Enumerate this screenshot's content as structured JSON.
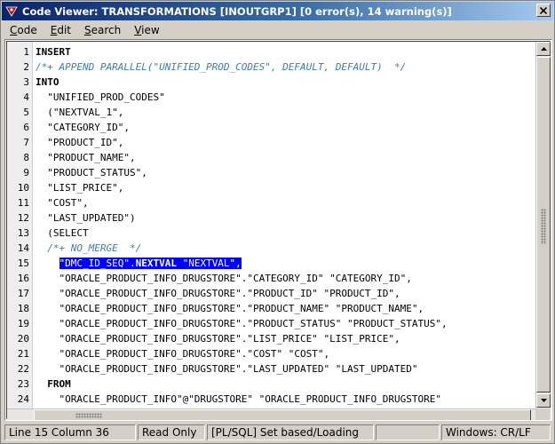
{
  "window": {
    "title": "Code Viewer: TRANSFORMATIONS [INOUTGRP1] [0 error(s), 14 warning(s)]"
  },
  "menu": [
    {
      "underline": "C",
      "rest": "ode"
    },
    {
      "underline": "E",
      "rest": "dit"
    },
    {
      "underline": "S",
      "rest": "earch"
    },
    {
      "underline": "V",
      "rest": "iew"
    }
  ],
  "code": {
    "lines": [
      {
        "n": "1",
        "segs": [
          [
            "kw",
            "INSERT"
          ]
        ]
      },
      {
        "n": "2",
        "segs": [
          [
            "cm",
            "/*+ APPEND PARALLEL(\"UNIFIED_PROD_CODES\", DEFAULT, DEFAULT)  */"
          ]
        ]
      },
      {
        "n": "3",
        "segs": [
          [
            "kw",
            "INTO"
          ]
        ]
      },
      {
        "n": "4",
        "segs": [
          [
            "",
            "  \"UNIFIED_PROD_CODES\""
          ]
        ]
      },
      {
        "n": "5",
        "segs": [
          [
            "",
            "  (\"NEXTVAL_1\","
          ]
        ]
      },
      {
        "n": "6",
        "segs": [
          [
            "",
            "  \"CATEGORY_ID\","
          ]
        ]
      },
      {
        "n": "7",
        "segs": [
          [
            "",
            "  \"PRODUCT_ID\","
          ]
        ]
      },
      {
        "n": "8",
        "segs": [
          [
            "",
            "  \"PRODUCT_NAME\","
          ]
        ]
      },
      {
        "n": "9",
        "segs": [
          [
            "",
            "  \"PRODUCT_STATUS\","
          ]
        ]
      },
      {
        "n": "10",
        "segs": [
          [
            "",
            "  \"LIST_PRICE\","
          ]
        ]
      },
      {
        "n": "11",
        "segs": [
          [
            "",
            "  \"COST\","
          ]
        ]
      },
      {
        "n": "12",
        "segs": [
          [
            "",
            "  \"LAST_UPDATED\")"
          ]
        ]
      },
      {
        "n": "13",
        "segs": [
          [
            "",
            "  (SELECT"
          ]
        ]
      },
      {
        "n": "14",
        "segs": [
          [
            "",
            "  "
          ],
          [
            "cm",
            "/*+ NO_MERGE  */"
          ]
        ]
      },
      {
        "n": "15",
        "segs": [
          [
            "",
            "    "
          ],
          [
            "hl",
            "\"DMC_ID_SEQ\"."
          ],
          [
            "hl kw",
            "NEXTVAL"
          ],
          [
            "hl",
            " \"NEXTVAL\","
          ]
        ]
      },
      {
        "n": "16",
        "segs": [
          [
            "",
            "    \"ORACLE_PRODUCT_INFO_DRUGSTORE\".\"CATEGORY_ID\" \"CATEGORY_ID\","
          ]
        ]
      },
      {
        "n": "17",
        "segs": [
          [
            "",
            "    \"ORACLE_PRODUCT_INFO_DRUGSTORE\".\"PRODUCT_ID\" \"PRODUCT_ID\","
          ]
        ]
      },
      {
        "n": "18",
        "segs": [
          [
            "",
            "    \"ORACLE_PRODUCT_INFO_DRUGSTORE\".\"PRODUCT_NAME\" \"PRODUCT_NAME\","
          ]
        ]
      },
      {
        "n": "19",
        "segs": [
          [
            "",
            "    \"ORACLE_PRODUCT_INFO_DRUGSTORE\".\"PRODUCT_STATUS\" \"PRODUCT_STATUS\","
          ]
        ]
      },
      {
        "n": "20",
        "segs": [
          [
            "",
            "    \"ORACLE_PRODUCT_INFO_DRUGSTORE\".\"LIST_PRICE\" \"LIST_PRICE\","
          ]
        ]
      },
      {
        "n": "21",
        "segs": [
          [
            "",
            "    \"ORACLE_PRODUCT_INFO_DRUGSTORE\".\"COST\" \"COST\","
          ]
        ]
      },
      {
        "n": "22",
        "segs": [
          [
            "",
            "    \"ORACLE_PRODUCT_INFO_DRUGSTORE\".\"LAST_UPDATED\" \"LAST_UPDATED\""
          ]
        ]
      },
      {
        "n": "23",
        "segs": [
          [
            "",
            "  "
          ],
          [
            "kw",
            "FROM"
          ]
        ]
      },
      {
        "n": "24",
        "segs": [
          [
            "",
            "    \"ORACLE_PRODUCT_INFO\"@\"DRUGSTORE\" \"ORACLE_PRODUCT_INFO_DRUGSTORE\""
          ]
        ]
      }
    ]
  },
  "status": {
    "position": "Line 15 Column 36",
    "mode": "Read Only",
    "language": "[PL/SQL] Set based/Loading",
    "line_endings": "Windows: CR/LF"
  },
  "icons": {
    "app": "code-viewer-icon",
    "close": "close-icon",
    "scroll_up": "arrow-up-icon",
    "scroll_down": "arrow-down-icon"
  },
  "colors": {
    "title_start": "#0a246a",
    "title_end": "#a6caf0",
    "selection": "#0000ff",
    "comment": "#3f7f9f"
  }
}
